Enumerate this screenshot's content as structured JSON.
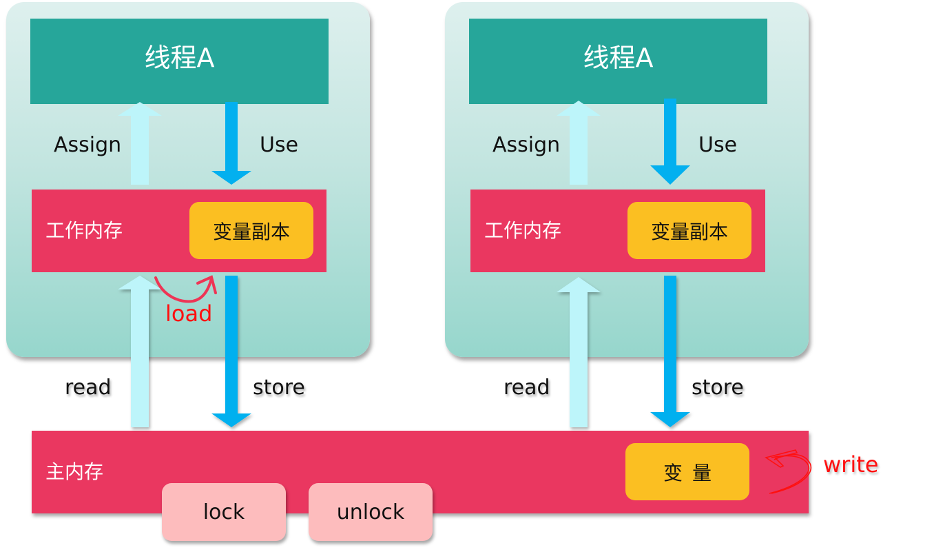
{
  "colors": {
    "thread_header": "#26a69a",
    "working_memory": "#ea3760",
    "variable_box": "#fbbf22",
    "lock_pill": "#fdbcbd",
    "arrow_up": "#bdf5fa",
    "arrow_down": "#03b0ef",
    "annotation": "#ff1010"
  },
  "threads": [
    {
      "title": "线程A",
      "assign_label": "Assign",
      "use_label": "Use",
      "working_memory_label": "工作内存",
      "variable_copy_label": "变量副本",
      "read_label": "read",
      "store_label": "store",
      "load_label": "load"
    },
    {
      "title": "线程A",
      "assign_label": "Assign",
      "use_label": "Use",
      "working_memory_label": "工作内存",
      "variable_copy_label": "变量副本",
      "read_label": "read",
      "store_label": "store"
    }
  ],
  "main_memory": {
    "label": "主内存",
    "lock_label": "lock",
    "unlock_label": "unlock",
    "variable_label": "变量",
    "write_label": "write"
  }
}
